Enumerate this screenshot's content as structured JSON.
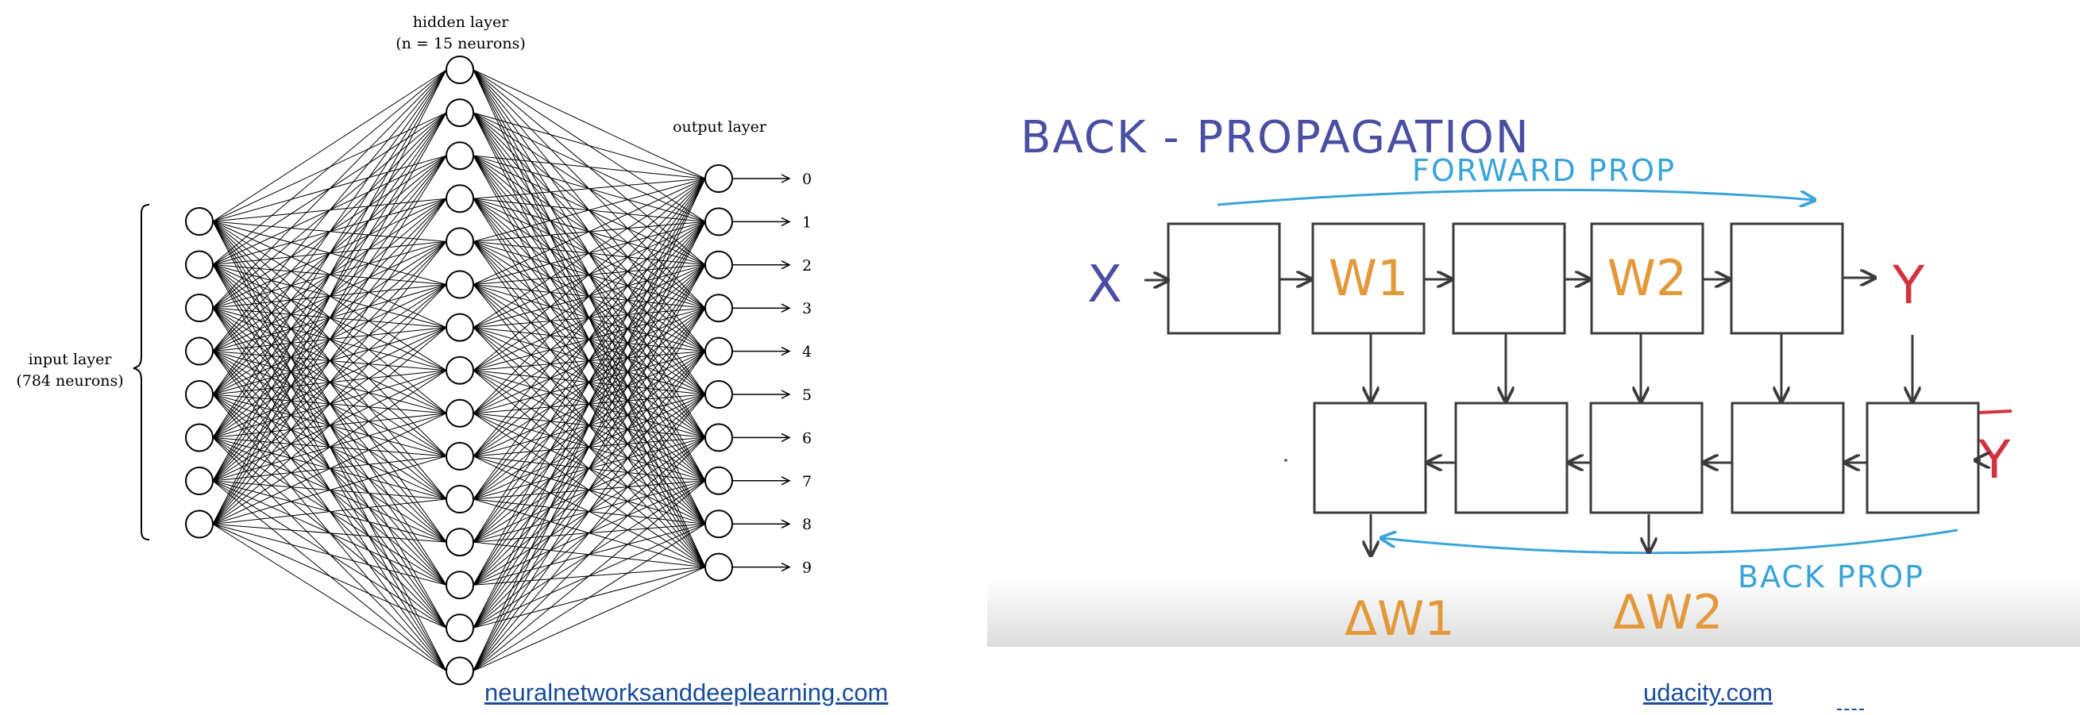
{
  "left_figure": {
    "hidden_title": "hidden layer",
    "hidden_subtitle": "(n = 15 neurons)",
    "output_title": "output layer",
    "input_title": "input layer",
    "input_subtitle": "(784 neurons)",
    "output_labels": [
      "0",
      "1",
      "2",
      "3",
      "4",
      "5",
      "6",
      "7",
      "8",
      "9"
    ],
    "input_count": 8,
    "hidden_count": 15,
    "output_count": 10,
    "source_link": "neuralnetworksanddeeplearning.com"
  },
  "right_figure": {
    "title": "BACK - PROPAGATION",
    "forward_label": "FORWARD PROP",
    "back_label": "BACK PROP",
    "input_symbol": "X",
    "output_symbol": "Y",
    "target_symbol": "Y",
    "top_box_labels": [
      "",
      "W1",
      "",
      "W2",
      ""
    ],
    "delta_labels": [
      "ΔW1",
      "ΔW2"
    ],
    "colors": {
      "ink": "#3b3b3b",
      "blue_ink": "#4a4fa3",
      "red_ink": "#d2333f",
      "orange_ink": "#e3983a",
      "arrow_blue": "#3aa4d8"
    },
    "source_link": "udacity.com"
  }
}
